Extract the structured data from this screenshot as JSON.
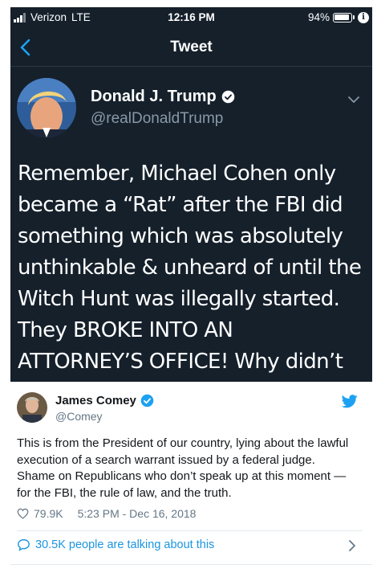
{
  "status_bar": {
    "carrier": "Verizon",
    "network": "LTE",
    "time": "12:16 PM",
    "battery": "94%"
  },
  "nav": {
    "title": "Tweet",
    "back_icon": "chevron-left-icon"
  },
  "quoted_tweet": {
    "author_name": "Donald J. Trump",
    "author_handle": "@realDonaldTrump",
    "text": "Remember, Michael Cohen only\nbecame a “Rat” after the FBI did\nsomething which was absolutely\nunthinkable & unheard of until the\nWitch Hunt was illegally started.\nThey BROKE INTO AN\nATTORNEY’S OFFICE! Why didn’t",
    "verified_icon": "verified-badge-icon",
    "menu_icon": "chevron-down-icon"
  },
  "embed": {
    "author_name": "James Comey",
    "author_handle": "@Comey",
    "text": "This is from the President of our country, lying about the lawful execution of a search warrant issued by a federal judge. Shame on Republicans who don’t speak up at this moment — for the FBI, the rule of law, and the truth.",
    "likes": "79.9K",
    "timestamp": "5:23 PM - Dec 16, 2018",
    "talking": "30.5K people are talking about this",
    "colors": {
      "link": "#1b95e0",
      "muted": "#657786",
      "dark_bg": "#15202b"
    }
  }
}
